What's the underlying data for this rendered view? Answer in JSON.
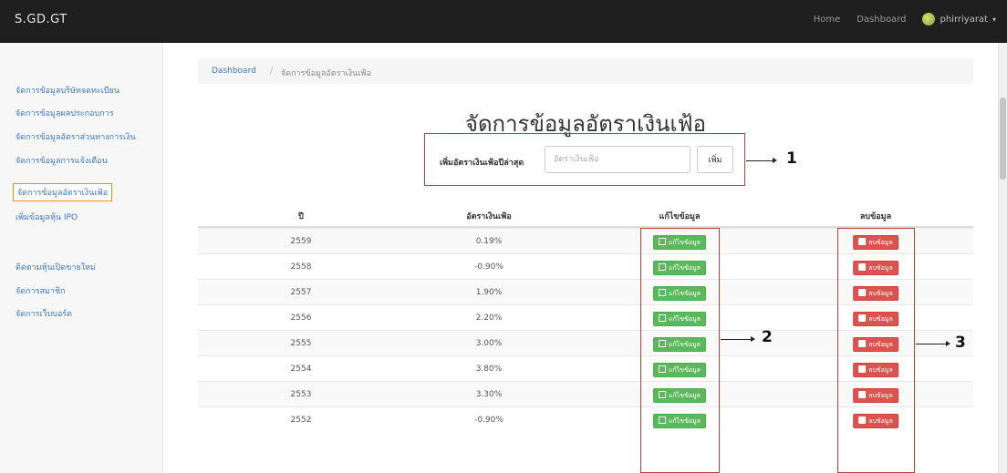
{
  "navbar": {
    "brand": "S.GD.GT",
    "links": [
      "Home",
      "Dashboard"
    ],
    "user": "phirriyarat"
  },
  "sidebar": {
    "items": [
      "จัดการข้อมูลบริษัทจดทะเบียน",
      "จัดการข้อมูลผลประกอบการ",
      "จัดการข้อมูลอัตราส่วนทางการเงิน",
      "จัดการข้อมูลการแจ้งเตือน",
      "จัดการข้อมูลอัตราเงินเฟ้อ",
      "เพิ่มข้อมูลหุ้น IPO",
      "ติดตามหุ้นเปิดขายใหม่",
      "จัดการสมาชิก",
      "จัดการเว็บบอร์ด"
    ],
    "active_index": 4
  },
  "breadcrumb": {
    "home": "Dashboard",
    "separator": "/",
    "current": "จัดการข้อมูลอัตราเงินเฟ้อ"
  },
  "page_title": "จัดการข้อมูลอัตราเงินเฟ้อ",
  "form": {
    "label": "เพิ่มอัตราเงินเฟ้อปีล่าสุด",
    "placeholder": "อัตราเงินเฟ้อ",
    "button": "เพิ่ม"
  },
  "table": {
    "headers": [
      "ปี",
      "อัตราเงินเฟ้อ",
      "แก้ไขข้อมูล",
      "ลบข้อมูล"
    ],
    "edit_label": "แก้ไขข้อมูล",
    "delete_label": "ลบข้อมูล",
    "rows": [
      {
        "year": "2559",
        "rate": "0.19%"
      },
      {
        "year": "2558",
        "rate": "-0.90%"
      },
      {
        "year": "2557",
        "rate": "1.90%"
      },
      {
        "year": "2556",
        "rate": "2.20%"
      },
      {
        "year": "2555",
        "rate": "3.00%"
      },
      {
        "year": "2554",
        "rate": "3.80%"
      },
      {
        "year": "2553",
        "rate": "3.30%"
      },
      {
        "year": "2552",
        "rate": "-0.90%"
      }
    ]
  },
  "annotations": [
    "1",
    "2",
    "3"
  ],
  "colors": {
    "navbar": "#1f1f1f",
    "link": "#3c78c0",
    "edit_button": "#5cb85c",
    "delete_button": "#d9534f",
    "annotation_box": "#b5433e",
    "active_sidebar_border": "#f08a24"
  }
}
